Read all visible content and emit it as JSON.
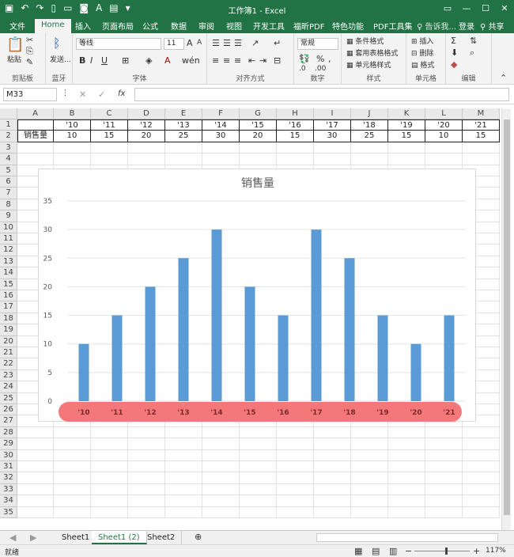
{
  "window": {
    "title": "工作簿1 - Excel"
  },
  "ribbon_tabs": [
    "文件",
    "Home",
    "插入",
    "页面布局",
    "公式",
    "数据",
    "审阅",
    "视图",
    "开发工具",
    "福昕PDF",
    "特色功能",
    "PDF工具集"
  ],
  "tell_me": "告诉我...",
  "login": "登录",
  "share": "共享",
  "ribbon": {
    "clipboard": {
      "label": "剪贴板",
      "paste": "粘贴"
    },
    "bluetooth": {
      "label": "蓝牙",
      "send": "发送..."
    },
    "font": {
      "label": "字体",
      "name": "等线",
      "size": "11"
    },
    "alignment": {
      "label": "对齐方式"
    },
    "number": {
      "label": "数字",
      "format": "常规"
    },
    "styles": {
      "label": "样式",
      "items": [
        "条件格式",
        "套用表格格式",
        "单元格样式"
      ]
    },
    "cells": {
      "label": "单元格",
      "items": [
        "插入",
        "删除",
        "格式"
      ]
    },
    "editing": {
      "label": "编辑"
    }
  },
  "formula_bar": {
    "name_box": "M33",
    "fx": "fx",
    "value": ""
  },
  "columns": [
    "A",
    "B",
    "C",
    "D",
    "E",
    "F",
    "G",
    "H",
    "I",
    "J",
    "K",
    "L",
    "M"
  ],
  "rows": [
    "1",
    "2",
    "3",
    "4",
    "5",
    "6",
    "7",
    "8",
    "9",
    "10",
    "11",
    "12",
    "13",
    "14",
    "15",
    "16",
    "17",
    "18",
    "19",
    "20",
    "21",
    "22",
    "23",
    "24",
    "25",
    "26",
    "27",
    "28",
    "29",
    "30",
    "31",
    "32",
    "33",
    "34",
    "35"
  ],
  "sheet": {
    "row1": [
      "",
      "'10",
      "'11",
      "'12",
      "'13",
      "'14",
      "'15",
      "'16",
      "'17",
      "'18",
      "'19",
      "'20",
      "'21"
    ],
    "row2": [
      "销售量",
      "10",
      "15",
      "20",
      "25",
      "30",
      "20",
      "15",
      "30",
      "25",
      "15",
      "10",
      "15"
    ]
  },
  "chart_data": {
    "type": "bar",
    "title": "销售量",
    "categories": [
      "'10",
      "'11",
      "'12",
      "'13",
      "'14",
      "'15",
      "'16",
      "'17",
      "'18",
      "'19",
      "'20",
      "'21"
    ],
    "values": [
      10,
      15,
      20,
      25,
      30,
      20,
      15,
      30,
      25,
      15,
      10,
      15
    ],
    "ylim": [
      0,
      35
    ],
    "yticks": [
      0,
      5,
      10,
      15,
      20,
      25,
      30,
      35
    ],
    "bar_color": "#5b9bd5",
    "category_band_color": "#f4787a",
    "grid": true
  },
  "sheet_tabs": [
    "Sheet1",
    "Sheet1 (2)",
    "Sheet2"
  ],
  "active_sheet": "Sheet1 (2)",
  "status": {
    "mode": "就绪",
    "zoom": "117%"
  }
}
